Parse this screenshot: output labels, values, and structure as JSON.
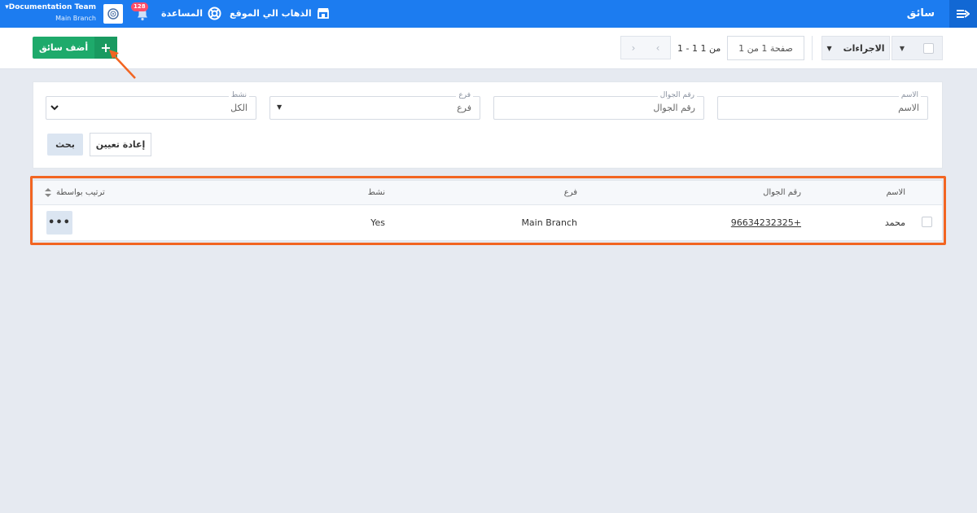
{
  "topbar": {
    "page_title": "سائق",
    "team_name": "Documentation Team",
    "branch": "Main Branch",
    "notification_count": "128",
    "help_label": "المساعدة",
    "go_site_label": "الذهاب الي الموقع"
  },
  "toolbar": {
    "add_label": "أضف سائق",
    "add_plus": "+",
    "pager_count": "1 - 1 من 1",
    "pager_page": "صفحة 1 من 1",
    "actions_label": "الاجراءات",
    "prev_arrow": "‹",
    "next_arrow": "›"
  },
  "filters": {
    "name": {
      "label": "الاسم",
      "placeholder": "الاسم"
    },
    "phone": {
      "label": "رقم الجوال",
      "placeholder": "رقم الجوال"
    },
    "branch": {
      "label": "فرع",
      "value": "فرع"
    },
    "active": {
      "label": "نشط",
      "value": "الكل"
    },
    "reset_label": "إعادة تعيين",
    "search_label": "بحث"
  },
  "table": {
    "columns": {
      "name": "الاسم",
      "phone": "رقم الجوال",
      "branch": "فرع",
      "active": "نشط",
      "sort": "ترتيب بواسطة"
    },
    "rows": [
      {
        "name": "محمد",
        "phone": "96634232325+",
        "branch": "Main Branch",
        "active": "Yes",
        "more": "•••"
      }
    ]
  },
  "colors": {
    "topbar": "#1c7cf0",
    "add_button": "#1eaa6b",
    "annotation": "#f26522"
  }
}
